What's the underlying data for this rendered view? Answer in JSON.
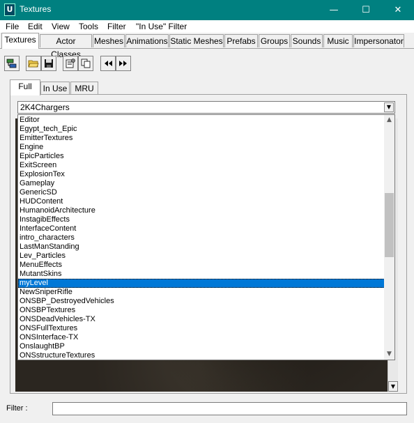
{
  "window": {
    "title": "Textures",
    "minimize": "—",
    "maximize": "☐",
    "close": "✕"
  },
  "menu": [
    "File",
    "Edit",
    "View",
    "Tools",
    "Filter",
    "\"In Use\" Filter"
  ],
  "tabs": [
    "Textures",
    "Actor Classes",
    "Meshes",
    "Animations",
    "Static Meshes",
    "Prefabs",
    "Groups",
    "Sounds",
    "Music",
    "Impersonator"
  ],
  "active_tab": "Textures",
  "toolbar": {
    "icons": [
      "sync-icon",
      "open-folder-icon",
      "save-icon",
      "properties-icon",
      "copy-icon",
      "previous-icon",
      "next-icon"
    ]
  },
  "subtabs": [
    "Full",
    "In Use",
    "MRU"
  ],
  "active_subtab": "Full",
  "package_combo": {
    "value": "2K4Chargers"
  },
  "package_list": {
    "items": [
      "Editor",
      "Egypt_tech_Epic",
      "EmitterTextures",
      "Engine",
      "EpicParticles",
      "ExitScreen",
      "ExplosionTex",
      "Gameplay",
      "GenericSD",
      "HUDContent",
      "HumanoidArchitecture",
      "InstagibEffects",
      "InterfaceContent",
      "intro_characters",
      "LastManStanding",
      "Lev_Particles",
      "MenuEffects",
      "MutantSkins",
      "myLevel",
      "NewSniperRifle",
      "ONSBP_DestroyedVehicles",
      "ONSBPTextures",
      "ONSDeadVehicles-TX",
      "ONSFullTextures",
      "ONSInterface-TX",
      "OnslaughtBP",
      "ONSstructureTextures"
    ],
    "selected": "myLevel"
  },
  "filter": {
    "label": "Filter :",
    "value": ""
  },
  "colors": {
    "titlebar": "#008080",
    "selection": "#0078d7"
  }
}
